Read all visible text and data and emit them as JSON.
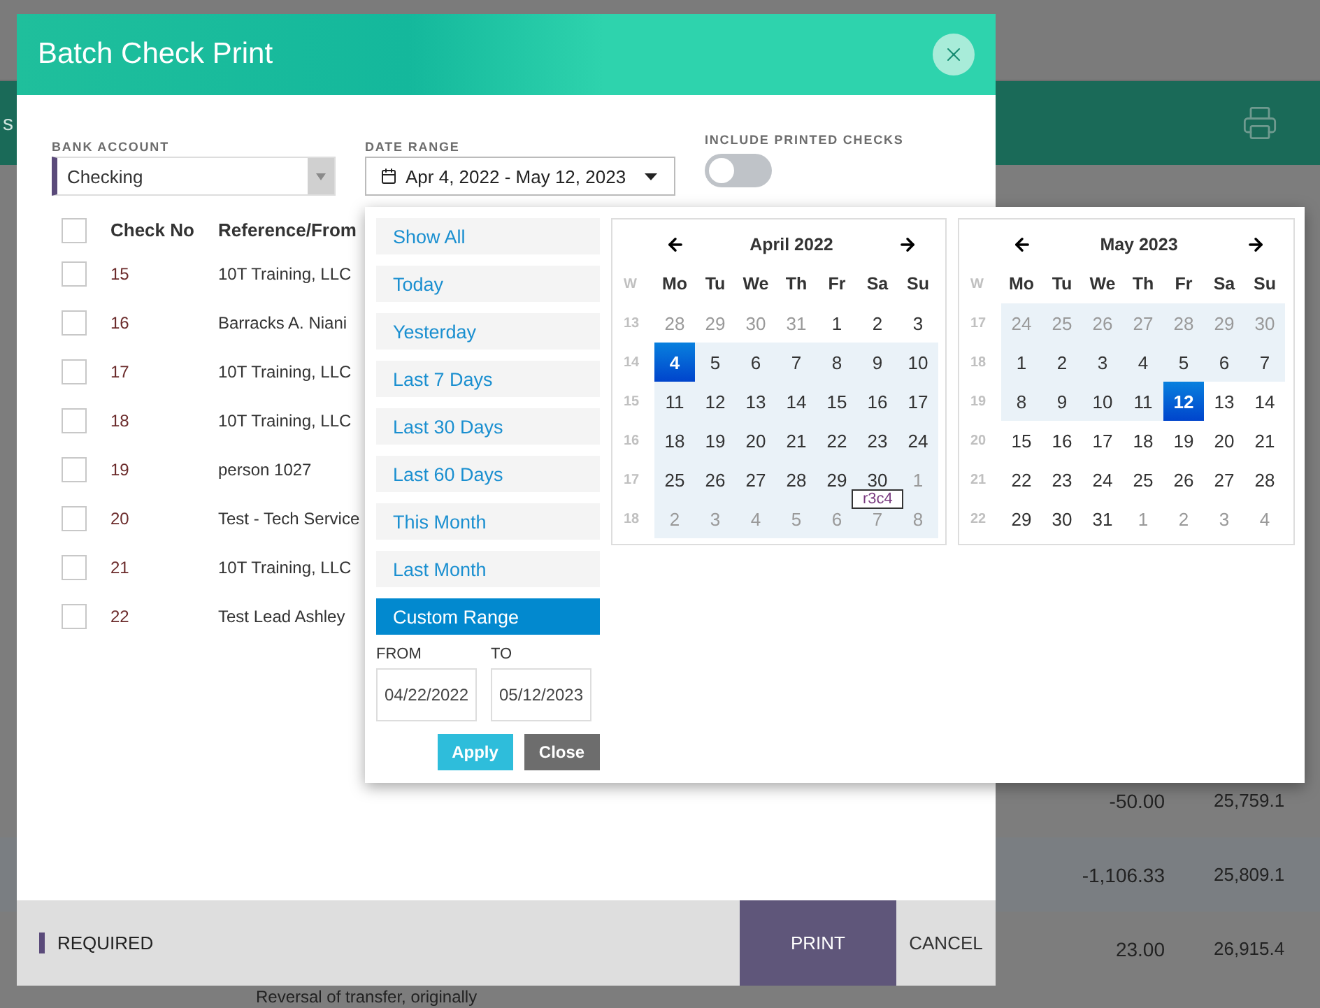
{
  "background": {
    "toolbar_fragment": "s",
    "rows": [
      {
        "amount": "-50.00",
        "balance": "25,759.1"
      },
      {
        "amount": "-1,106.33",
        "balance": "25,809.1"
      },
      {
        "amount": "23.00",
        "balance": "26,915.4"
      }
    ],
    "bottom_text": "Reversal of transfer, originally"
  },
  "dialog": {
    "title": "Batch Check Print",
    "bank_account": {
      "label": "BANK ACCOUNT",
      "value": "Checking",
      "required": true
    },
    "date_range": {
      "label": "DATE RANGE",
      "value": "Apr 4, 2022 - May 12, 2023"
    },
    "include_printed": {
      "label": "INCLUDE PRINTED CHECKS",
      "on": false
    },
    "table": {
      "all_checked": false,
      "columns": [
        "Check No",
        "Reference/From"
      ],
      "rows": [
        {
          "no": "15",
          "ref": "10T Training, LLC",
          "checked": false
        },
        {
          "no": "16",
          "ref": "Barracks A. Niani",
          "checked": false
        },
        {
          "no": "17",
          "ref": "10T Training, LLC",
          "checked": false
        },
        {
          "no": "18",
          "ref": "10T Training, LLC",
          "checked": false
        },
        {
          "no": "19",
          "ref": "person 1027",
          "checked": false
        },
        {
          "no": "20",
          "ref": "Test - Tech Service",
          "checked": false
        },
        {
          "no": "21",
          "ref": "10T Training, LLC",
          "checked": false
        },
        {
          "no": "22",
          "ref": "Test Lead Ashley",
          "checked": false
        }
      ]
    },
    "footer": {
      "required_label": "REQUIRED",
      "buttons": [
        "PRINT",
        "CANCEL"
      ]
    }
  },
  "date_picker": {
    "ranges": [
      {
        "label": "Show All",
        "selected": false
      },
      {
        "label": "Today",
        "selected": false
      },
      {
        "label": "Yesterday",
        "selected": false
      },
      {
        "label": "Last 7 Days",
        "selected": false
      },
      {
        "label": "Last 30 Days",
        "selected": false
      },
      {
        "label": "Last 60 Days",
        "selected": false
      },
      {
        "label": "This Month",
        "selected": false
      },
      {
        "label": "Last Month",
        "selected": false
      },
      {
        "label": "Custom Range",
        "selected": true
      }
    ],
    "from": {
      "label": "FROM",
      "value": "04/22/2022"
    },
    "to": {
      "label": "TO",
      "value": "05/12/2023"
    },
    "buttons": [
      "Apply",
      "Close"
    ],
    "tooltip": "r3c4",
    "calendars": [
      {
        "title": "April 2022",
        "week_label": "W",
        "weekdays": [
          "Mo",
          "Tu",
          "We",
          "Th",
          "Fr",
          "Sa",
          "Su"
        ],
        "weeks": [
          {
            "w": "13",
            "days": [
              {
                "d": "28",
                "muted": true,
                "selected": false,
                "in_range": false
              },
              {
                "d": "29",
                "muted": true,
                "selected": false,
                "in_range": false
              },
              {
                "d": "30",
                "muted": true,
                "selected": false,
                "in_range": false
              },
              {
                "d": "31",
                "muted": true,
                "selected": false,
                "in_range": false
              },
              {
                "d": "1",
                "muted": false,
                "selected": false,
                "in_range": false
              },
              {
                "d": "2",
                "muted": false,
                "selected": false,
                "in_range": false
              },
              {
                "d": "3",
                "muted": false,
                "selected": false,
                "in_range": false
              }
            ]
          },
          {
            "w": "14",
            "days": [
              {
                "d": "4",
                "muted": false,
                "selected": true,
                "in_range": true
              },
              {
                "d": "5",
                "muted": false,
                "selected": false,
                "in_range": true
              },
              {
                "d": "6",
                "muted": false,
                "selected": false,
                "in_range": true
              },
              {
                "d": "7",
                "muted": false,
                "selected": false,
                "in_range": true
              },
              {
                "d": "8",
                "muted": false,
                "selected": false,
                "in_range": true
              },
              {
                "d": "9",
                "muted": false,
                "selected": false,
                "in_range": true
              },
              {
                "d": "10",
                "muted": false,
                "selected": false,
                "in_range": true
              }
            ]
          },
          {
            "w": "15",
            "days": [
              {
                "d": "11",
                "muted": false,
                "selected": false,
                "in_range": true
              },
              {
                "d": "12",
                "muted": false,
                "selected": false,
                "in_range": true
              },
              {
                "d": "13",
                "muted": false,
                "selected": false,
                "in_range": true
              },
              {
                "d": "14",
                "muted": false,
                "selected": false,
                "in_range": true
              },
              {
                "d": "15",
                "muted": false,
                "selected": false,
                "in_range": true
              },
              {
                "d": "16",
                "muted": false,
                "selected": false,
                "in_range": true
              },
              {
                "d": "17",
                "muted": false,
                "selected": false,
                "in_range": true
              }
            ]
          },
          {
            "w": "16",
            "days": [
              {
                "d": "18",
                "muted": false,
                "selected": false,
                "in_range": true
              },
              {
                "d": "19",
                "muted": false,
                "selected": false,
                "in_range": true
              },
              {
                "d": "20",
                "muted": false,
                "selected": false,
                "in_range": true
              },
              {
                "d": "21",
                "muted": false,
                "selected": false,
                "in_range": true
              },
              {
                "d": "22",
                "muted": false,
                "selected": false,
                "in_range": true
              },
              {
                "d": "23",
                "muted": false,
                "selected": false,
                "in_range": true
              },
              {
                "d": "24",
                "muted": false,
                "selected": false,
                "in_range": true
              }
            ]
          },
          {
            "w": "17",
            "days": [
              {
                "d": "25",
                "muted": false,
                "selected": false,
                "in_range": true
              },
              {
                "d": "26",
                "muted": false,
                "selected": false,
                "in_range": true
              },
              {
                "d": "27",
                "muted": false,
                "selected": false,
                "in_range": true
              },
              {
                "d": "28",
                "muted": false,
                "selected": false,
                "in_range": true
              },
              {
                "d": "29",
                "muted": false,
                "selected": false,
                "in_range": true
              },
              {
                "d": "30",
                "muted": false,
                "selected": false,
                "in_range": true
              },
              {
                "d": "1",
                "muted": true,
                "selected": false,
                "in_range": true
              }
            ]
          },
          {
            "w": "18",
            "days": [
              {
                "d": "2",
                "muted": true,
                "selected": false,
                "in_range": true
              },
              {
                "d": "3",
                "muted": true,
                "selected": false,
                "in_range": true
              },
              {
                "d": "4",
                "muted": true,
                "selected": false,
                "in_range": true
              },
              {
                "d": "5",
                "muted": true,
                "selected": false,
                "in_range": true
              },
              {
                "d": "6",
                "muted": true,
                "selected": false,
                "in_range": true
              },
              {
                "d": "7",
                "muted": true,
                "selected": false,
                "in_range": true
              },
              {
                "d": "8",
                "muted": true,
                "selected": false,
                "in_range": true
              }
            ]
          }
        ]
      },
      {
        "title": "May 2023",
        "week_label": "W",
        "weekdays": [
          "Mo",
          "Tu",
          "We",
          "Th",
          "Fr",
          "Sa",
          "Su"
        ],
        "weeks": [
          {
            "w": "17",
            "days": [
              {
                "d": "24",
                "muted": true,
                "selected": false,
                "in_range": true
              },
              {
                "d": "25",
                "muted": true,
                "selected": false,
                "in_range": true
              },
              {
                "d": "26",
                "muted": true,
                "selected": false,
                "in_range": true
              },
              {
                "d": "27",
                "muted": true,
                "selected": false,
                "in_range": true
              },
              {
                "d": "28",
                "muted": true,
                "selected": false,
                "in_range": true
              },
              {
                "d": "29",
                "muted": true,
                "selected": false,
                "in_range": true
              },
              {
                "d": "30",
                "muted": true,
                "selected": false,
                "in_range": true
              }
            ]
          },
          {
            "w": "18",
            "days": [
              {
                "d": "1",
                "muted": false,
                "selected": false,
                "in_range": true
              },
              {
                "d": "2",
                "muted": false,
                "selected": false,
                "in_range": true
              },
              {
                "d": "3",
                "muted": false,
                "selected": false,
                "in_range": true
              },
              {
                "d": "4",
                "muted": false,
                "selected": false,
                "in_range": true
              },
              {
                "d": "5",
                "muted": false,
                "selected": false,
                "in_range": true
              },
              {
                "d": "6",
                "muted": false,
                "selected": false,
                "in_range": true
              },
              {
                "d": "7",
                "muted": false,
                "selected": false,
                "in_range": true
              }
            ]
          },
          {
            "w": "19",
            "days": [
              {
                "d": "8",
                "muted": false,
                "selected": false,
                "in_range": true
              },
              {
                "d": "9",
                "muted": false,
                "selected": false,
                "in_range": true
              },
              {
                "d": "10",
                "muted": false,
                "selected": false,
                "in_range": true
              },
              {
                "d": "11",
                "muted": false,
                "selected": false,
                "in_range": true
              },
              {
                "d": "12",
                "muted": false,
                "selected": true,
                "in_range": true
              },
              {
                "d": "13",
                "muted": false,
                "selected": false,
                "in_range": false
              },
              {
                "d": "14",
                "muted": false,
                "selected": false,
                "in_range": false
              }
            ]
          },
          {
            "w": "20",
            "days": [
              {
                "d": "15",
                "muted": false,
                "selected": false,
                "in_range": false
              },
              {
                "d": "16",
                "muted": false,
                "selected": false,
                "in_range": false
              },
              {
                "d": "17",
                "muted": false,
                "selected": false,
                "in_range": false
              },
              {
                "d": "18",
                "muted": false,
                "selected": false,
                "in_range": false
              },
              {
                "d": "19",
                "muted": false,
                "selected": false,
                "in_range": false
              },
              {
                "d": "20",
                "muted": false,
                "selected": false,
                "in_range": false
              },
              {
                "d": "21",
                "muted": false,
                "selected": false,
                "in_range": false
              }
            ]
          },
          {
            "w": "21",
            "days": [
              {
                "d": "22",
                "muted": false,
                "selected": false,
                "in_range": false
              },
              {
                "d": "23",
                "muted": false,
                "selected": false,
                "in_range": false
              },
              {
                "d": "24",
                "muted": false,
                "selected": false,
                "in_range": false
              },
              {
                "d": "25",
                "muted": false,
                "selected": false,
                "in_range": false
              },
              {
                "d": "26",
                "muted": false,
                "selected": false,
                "in_range": false
              },
              {
                "d": "27",
                "muted": false,
                "selected": false,
                "in_range": false
              },
              {
                "d": "28",
                "muted": false,
                "selected": false,
                "in_range": false
              }
            ]
          },
          {
            "w": "22",
            "days": [
              {
                "d": "29",
                "muted": false,
                "selected": false,
                "in_range": false
              },
              {
                "d": "30",
                "muted": false,
                "selected": false,
                "in_range": false
              },
              {
                "d": "31",
                "muted": false,
                "selected": false,
                "in_range": false
              },
              {
                "d": "1",
                "muted": true,
                "selected": false,
                "in_range": false
              },
              {
                "d": "2",
                "muted": true,
                "selected": false,
                "in_range": false
              },
              {
                "d": "3",
                "muted": true,
                "selected": false,
                "in_range": false
              },
              {
                "d": "4",
                "muted": true,
                "selected": false,
                "in_range": false
              }
            ]
          }
        ]
      }
    ]
  }
}
